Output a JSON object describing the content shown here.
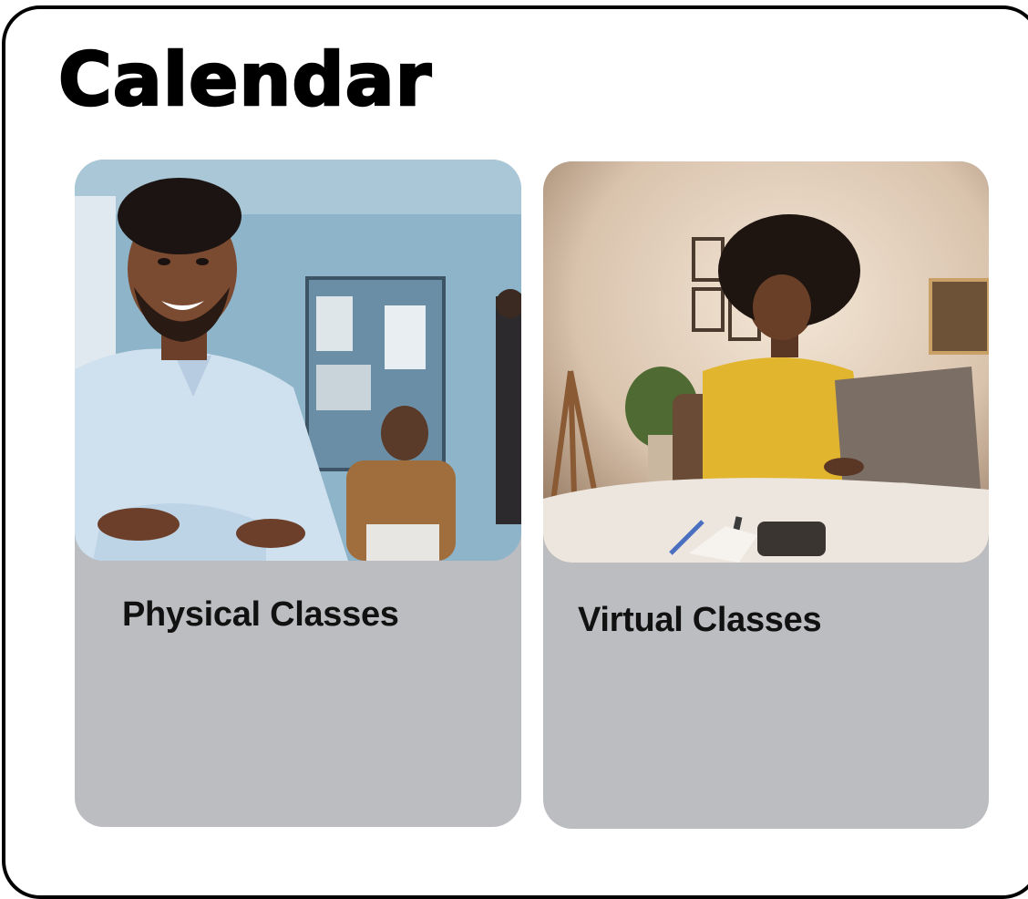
{
  "page": {
    "title": "Calendar"
  },
  "cards": [
    {
      "label": "Physical Classes",
      "image_subject": "smiling man in light blue shirt in classroom",
      "card_color": "#bcbdc0"
    },
    {
      "label": "Virtual Classes",
      "image_subject": "woman in yellow sweater working on laptop at home",
      "card_color": "#bcbdc0"
    }
  ],
  "colors": {
    "frame_border": "#000000",
    "title_text": "#000000",
    "card_text": "#111111"
  }
}
